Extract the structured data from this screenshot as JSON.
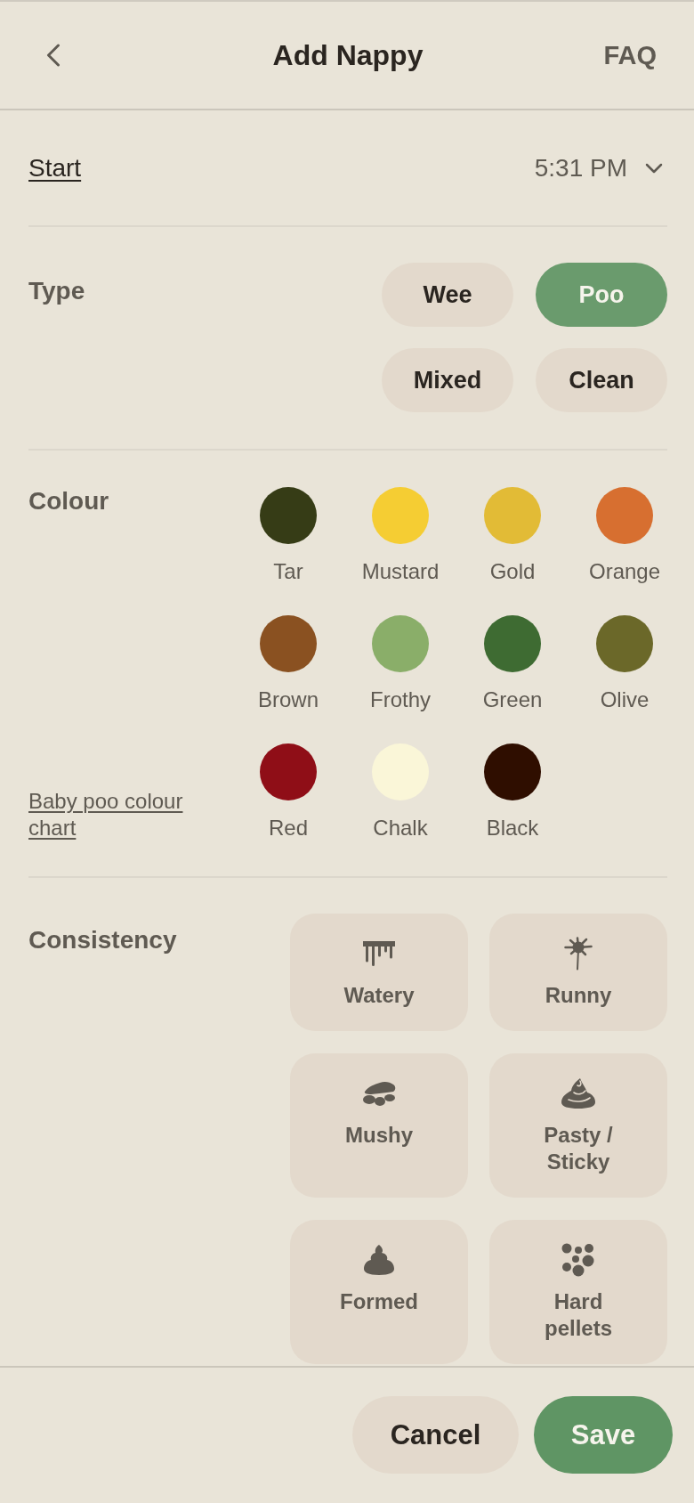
{
  "header": {
    "title": "Add Nappy",
    "action": "FAQ"
  },
  "start": {
    "label": "Start",
    "value": "5:31 PM"
  },
  "type": {
    "label": "Type",
    "options": [
      {
        "label": "Wee",
        "selected": false
      },
      {
        "label": "Poo",
        "selected": true
      },
      {
        "label": "Mixed",
        "selected": false
      },
      {
        "label": "Clean",
        "selected": false
      }
    ]
  },
  "colour": {
    "label": "Colour",
    "link": "Baby poo colour chart",
    "swatches": [
      {
        "name": "Tar",
        "color": "#363c16",
        "selected": false
      },
      {
        "name": "Mustard",
        "color": "#f5cd33",
        "selected": false
      },
      {
        "name": "Gold",
        "color": "#e2bb36",
        "selected": false
      },
      {
        "name": "Orange",
        "color": "#d76f30",
        "selected": false
      },
      {
        "name": "Brown",
        "color": "#8a5121",
        "selected": false
      },
      {
        "name": "Frothy",
        "color": "#8aae69",
        "selected": false
      },
      {
        "name": "Green",
        "color": "#3e6b32",
        "selected": false
      },
      {
        "name": "Olive",
        "color": "#6b6829",
        "selected": false
      },
      {
        "name": "Red",
        "color": "#8f0e17",
        "selected": false
      },
      {
        "name": "Chalk",
        "color": "#faf6d8",
        "selected": false
      },
      {
        "name": "Black",
        "color": "#2f0e00",
        "selected": false
      }
    ]
  },
  "consistency": {
    "label": "Consistency",
    "options": [
      {
        "label": "Watery",
        "selected": false
      },
      {
        "label": "Runny",
        "selected": false
      },
      {
        "label": "Mushy",
        "selected": false
      },
      {
        "label": "Pasty / Sticky",
        "selected": false
      },
      {
        "label": "Formed",
        "selected": false
      },
      {
        "label": "Hard pellets",
        "selected": false
      }
    ]
  },
  "footer": {
    "buttons": [
      {
        "label": "Cancel",
        "kind": "secondary"
      },
      {
        "label": "Save",
        "kind": "primary"
      }
    ]
  }
}
